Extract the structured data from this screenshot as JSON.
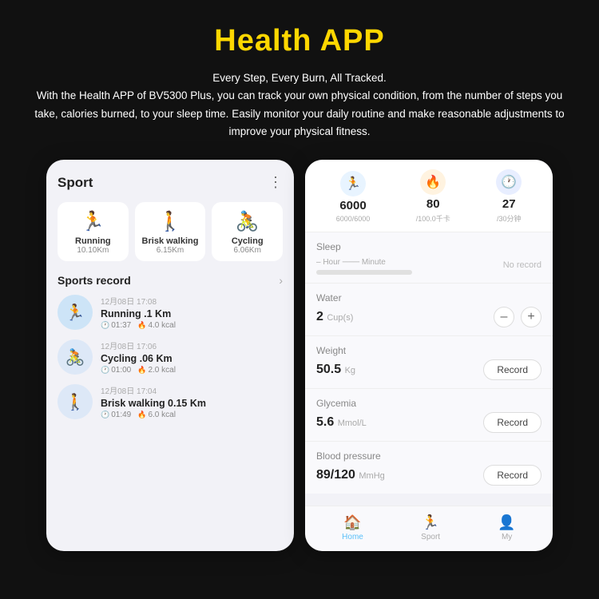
{
  "page": {
    "title": "Health APP",
    "description_line1": "Every Step, Every Burn, All Tracked.",
    "description_line2": "With the Health APP of BV5300 Plus, you can track your own physical condition, from the number of steps you take, calories burned, to your sleep time. Easily monitor your daily routine and make reasonable adjustments to improve your physical fitness."
  },
  "left_phone": {
    "header": "Sport",
    "sport_cards": [
      {
        "icon": "🏃",
        "label": "Running",
        "dist": "10.10Km"
      },
      {
        "icon": "🚶",
        "label": "Brisk walking",
        "dist": "6.15Km"
      },
      {
        "icon": "🚴",
        "label": "Cycling",
        "dist": "6.06Km"
      }
    ],
    "record_section_label": "Sports record",
    "records": [
      {
        "icon": "🏃",
        "avatar_type": "running",
        "date": "12月08日 17:08",
        "name": "Running  .1 Km",
        "time": "01:37",
        "kcal": "4.0 kcal"
      },
      {
        "icon": "🚴",
        "avatar_type": "cycling",
        "date": "12月08日 17:06",
        "name": "Cycling  .06 Km",
        "time": "01:00",
        "kcal": "2.0 kcal"
      },
      {
        "icon": "🚶",
        "avatar_type": "walking",
        "date": "12月08日 17:04",
        "name": "Brisk walking 0.15 Km",
        "time": "01:49",
        "kcal": "6.0 kcal"
      }
    ]
  },
  "right_phone": {
    "top_stats": {
      "steps": {
        "value": "6000",
        "sub": "6000/6000"
      },
      "calories": {
        "value": "80",
        "sub": "/100.0千卡"
      },
      "time": {
        "value": "27",
        "sub": "/30分钟"
      }
    },
    "health_items": [
      {
        "label": "Sleep",
        "value": "",
        "unit": "",
        "type": "sleep",
        "no_record": "No record",
        "hour_minute": "– Hour  ─── Minute"
      },
      {
        "label": "Water",
        "value": "2",
        "unit": "Cup(s)",
        "type": "water"
      },
      {
        "label": "Weight",
        "value": "50.5",
        "unit": "Kg",
        "type": "record",
        "btn": "Record"
      },
      {
        "label": "Glycemia",
        "value": "5.6",
        "unit": "Mmol/L",
        "type": "record",
        "btn": "Record"
      },
      {
        "label": "Blood pressure",
        "value": "89/120",
        "unit": "MmHg",
        "type": "record",
        "btn": "Record"
      }
    ],
    "nav": [
      {
        "icon": "🏠",
        "label": "Home",
        "active": true
      },
      {
        "icon": "🏃",
        "label": "Sport",
        "active": false
      },
      {
        "icon": "👤",
        "label": "My",
        "active": false
      }
    ]
  }
}
